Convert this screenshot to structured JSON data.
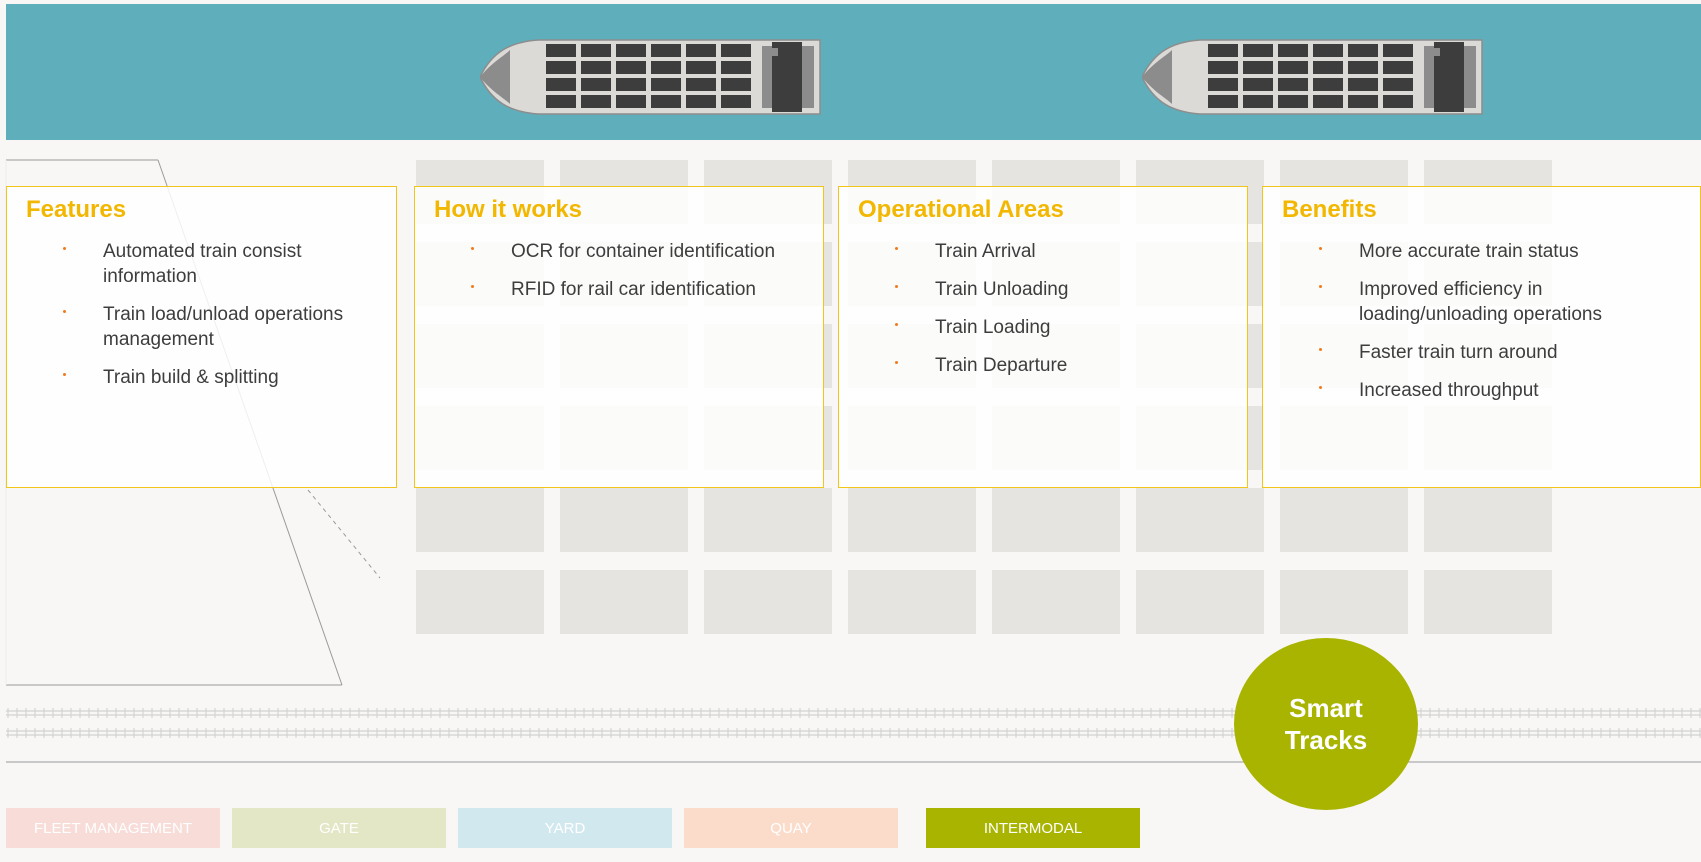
{
  "cards": {
    "features": {
      "title": "Features",
      "items": [
        "Automated train consist information",
        "Train load/unload operations management",
        "Train build & splitting"
      ]
    },
    "how": {
      "title": "How it works",
      "items": [
        "OCR for container identification",
        "RFID for rail car identification"
      ]
    },
    "ops": {
      "title": "Operational Areas",
      "items": [
        "Train Arrival",
        "Train Unloading",
        "Train Loading",
        "Train Departure"
      ]
    },
    "benefits": {
      "title": "Benefits",
      "items": [
        "More accurate train  status",
        "Improved efficiency in loading/unloading operations",
        "Faster train turn around",
        "Increased throughput"
      ]
    }
  },
  "smart_tracks": {
    "line1": "Smart",
    "line2": "Tracks"
  },
  "tabs": [
    {
      "label": "FLEET MANAGEMENT",
      "color": "#f7dcd8"
    },
    {
      "label": "GATE",
      "color": "#e3e7c5"
    },
    {
      "label": "YARD",
      "color": "#d2e8ef"
    },
    {
      "label": "QUAY",
      "color": "#fbdccb"
    },
    {
      "label": "INTERMODAL",
      "color": "#a8b400"
    }
  ],
  "colors": {
    "sea": "#5faebb",
    "accent_title": "#f2b700",
    "bullet": "#f07b1d",
    "smart_tracks": "#a8b400"
  }
}
